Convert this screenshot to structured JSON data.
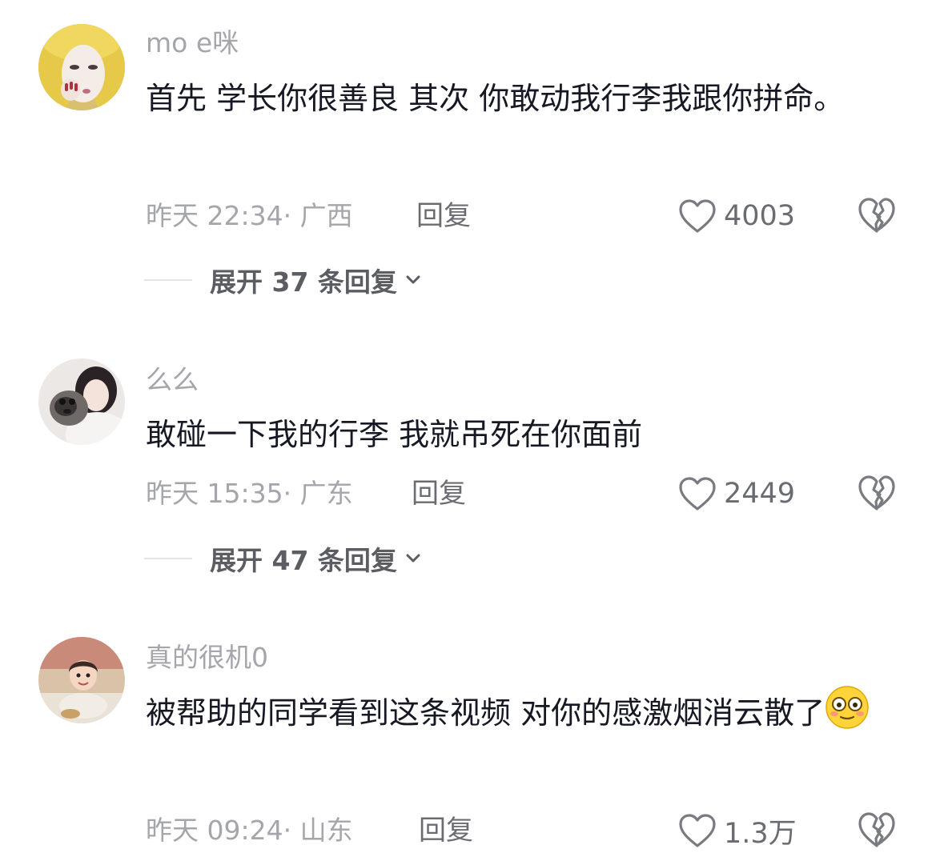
{
  "comments": [
    {
      "username": "mo e咪",
      "text": "首先 学长你很善良 其次 你敢动我行李我跟你拼命。",
      "meta": "昨天 22:34· 广西",
      "reply_label": "回复",
      "likes": "4003",
      "expand_label": "展开 37 条回复"
    },
    {
      "username": "么么",
      "text": "敢碰一下我的行李 我就吊死在你面前",
      "meta": "昨天 15:35· 广东",
      "reply_label": "回复",
      "likes": "2449",
      "expand_label": "展开 47 条回复"
    },
    {
      "username": "真的很机0",
      "text": "被帮助的同学看到这条视频 对你的感激烟消云散了",
      "emoji": "flushed-face-emoji",
      "meta": "昨天 09:24· 山东",
      "reply_label": "回复",
      "likes": "1.3万"
    }
  ],
  "icons": {
    "like": "heart-outline-icon",
    "dislike": "broken-heart-icon",
    "expand": "chevron-down-icon"
  },
  "colors": {
    "text_primary": "#161823",
    "text_secondary": "#a5a6ab",
    "text_action": "#6b6c72"
  }
}
